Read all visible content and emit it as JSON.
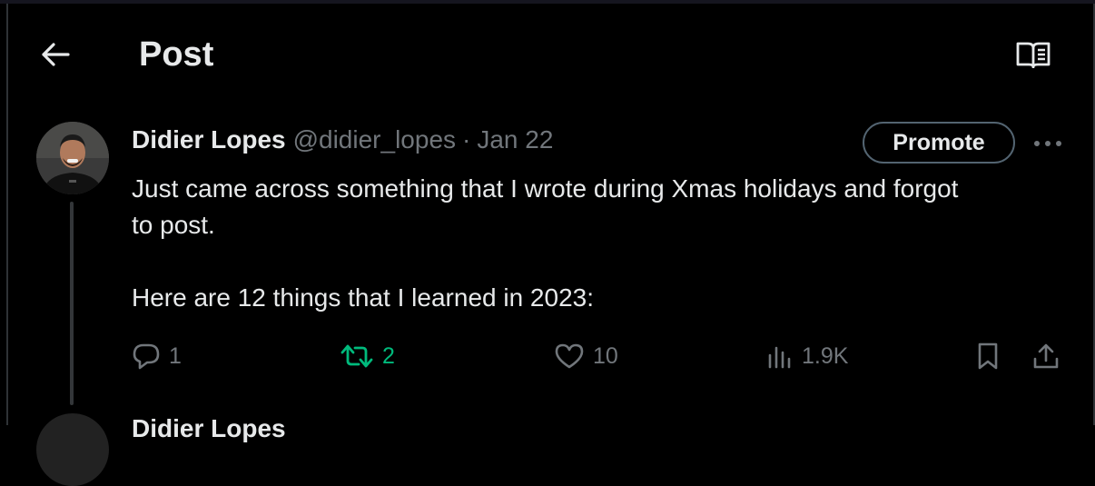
{
  "header": {
    "title": "Post",
    "back_icon": "arrow-left-icon",
    "reader_icon": "book-reader-icon"
  },
  "post": {
    "author_name": "Didier Lopes",
    "handle": "@didier_lopes",
    "separator": "·",
    "date": "Jan 22",
    "promote_label": "Promote",
    "more_icon": "more-horizontal-icon",
    "text_line_1": "Just came across something that I wrote during Xmas holidays and forgot",
    "text_line_2": "to post.",
    "text_line_3": "Here are 12 things that I learned in 2023:",
    "actions": {
      "reply_count": "1",
      "repost_count": "2",
      "like_count": "10",
      "views_count": "1.9K"
    }
  },
  "next_post": {
    "author_name_partial": "Didier Lopes"
  },
  "colors": {
    "background": "#000000",
    "text": "#e7e9ea",
    "muted": "#71767b",
    "repost_active": "#00ba7c",
    "border": "#2f3336"
  }
}
